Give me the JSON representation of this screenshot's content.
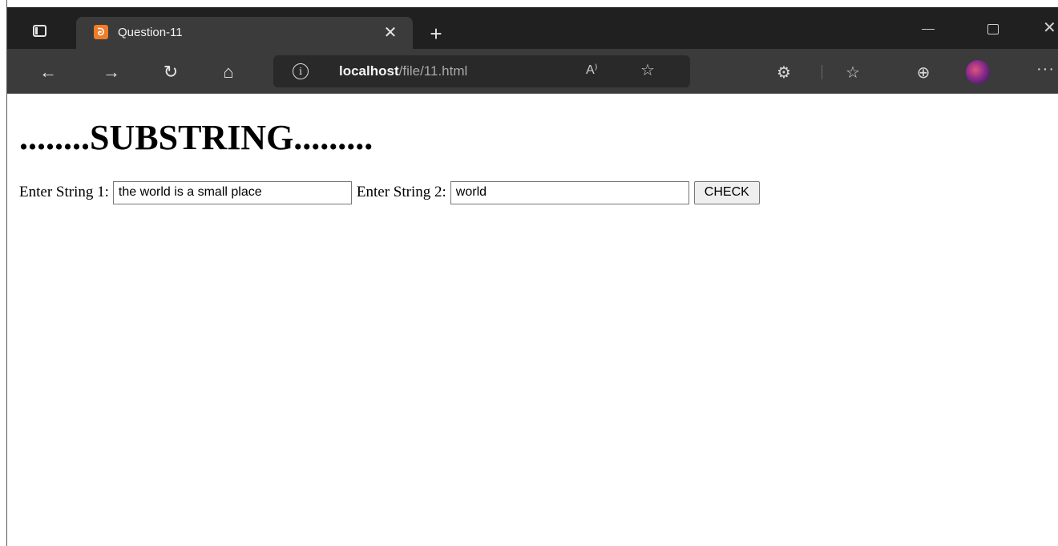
{
  "browser": {
    "tab_title": "Question-11",
    "tab_favicon_glyph": "ᘒ",
    "url_host": "localhost",
    "url_path": "/file/11.html",
    "read_aloud_label": "A⁾",
    "accent_favicon": "#f07c2a"
  },
  "page": {
    "heading": "........SUBSTRING.........",
    "label1": "Enter String 1:",
    "input1_value": "the world is a small place",
    "label2": "Enter String 2:",
    "input2_value": "world",
    "check_label": "CHECK"
  },
  "icons": [
    "tab-actions-icon",
    "close-icon",
    "plus-icon",
    "back-icon",
    "forward-icon",
    "refresh-icon",
    "home-icon",
    "info-icon",
    "read-aloud-icon",
    "add-favorite-icon",
    "extensions-icon",
    "favorites-icon",
    "collections-icon",
    "avatar",
    "more-icon"
  ]
}
